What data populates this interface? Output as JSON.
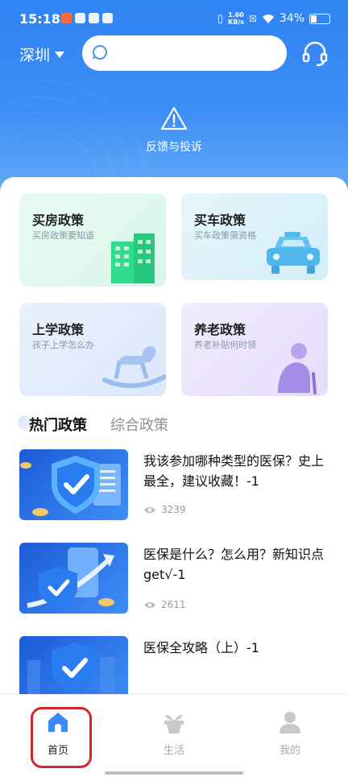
{
  "status": {
    "time": "15:18",
    "net_speed_value": "1.60",
    "net_speed_unit": "KB/s",
    "battery": "34%"
  },
  "header": {
    "city": "深圳",
    "search_placeholder": "",
    "complaint_label": "反馈与投诉"
  },
  "cards": [
    {
      "title": "买房政策",
      "subtitle": "买房政策要知道",
      "icon": "building-icon"
    },
    {
      "title": "买车政策",
      "subtitle": "买车政策需资格",
      "icon": "car-icon"
    },
    {
      "title": "上学政策",
      "subtitle": "孩子上学怎么办",
      "icon": "rocking-horse-icon"
    },
    {
      "title": "养老政策",
      "subtitle": "养老补贴何时领",
      "icon": "elderly-icon"
    }
  ],
  "tabs": {
    "active": "热门政策",
    "inactive": "综合政策"
  },
  "articles": [
    {
      "title": "我该参加哪种类型的医保？史上最全，建议收藏！-1",
      "views": "3239"
    },
    {
      "title": "医保是什么？怎么用？新知识点get√-1",
      "views": "2611"
    },
    {
      "title": "医保全攻略（上）-1",
      "views": ""
    }
  ],
  "nav": {
    "home": "首页",
    "life": "生活",
    "mine": "我的"
  },
  "colors": {
    "accent": "#3a8af5",
    "highlight": "#d3262a"
  }
}
